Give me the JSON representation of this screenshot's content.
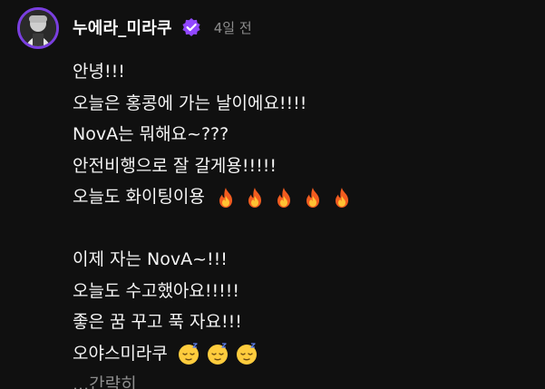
{
  "post": {
    "username": "누에라_미라쿠",
    "timestamp": "4일 전",
    "accent_color": "#7a3fe0",
    "verified_icon": "verified-badge-icon",
    "lines": [
      "안녕!!!",
      "오늘은 홍콩에 가는 날이에요!!!!",
      "NovA는 뭐해요~???",
      "안전비행으로 잘 갈게용!!!!!",
      "오늘도 화이팅이용",
      "",
      "이제 자는 NovA~!!!",
      "오늘도 수고했아요!!!!!",
      "좋은 꿈 꾸고 푹 자요!!!",
      "오야스미라쿠"
    ],
    "fire_emoji_count": 5,
    "sleepy_emoji_count": 3,
    "more_label": "...간략히"
  }
}
